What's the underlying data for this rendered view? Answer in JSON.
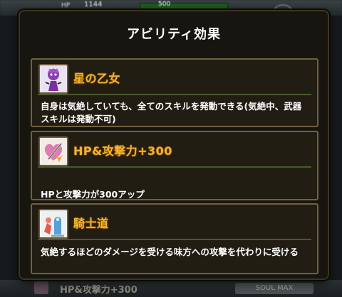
{
  "background": {
    "top_hp_label": "HP",
    "top_hp_value": "1144",
    "top_bar_value": "500",
    "bottom_ghost_title": "HP&攻撃力+300",
    "bottom_ghost_chip": "SOUL MAX"
  },
  "dialog": {
    "title": "アビリティ効果",
    "abilities": [
      {
        "name": "星の乙女",
        "icon": "purple-maiden-icon",
        "description": "自身は気絶していても、全てのスキルを発動できる(気絶中、武器スキルは発動不可)"
      },
      {
        "name": "HP&攻撃力+300",
        "icon": "heart-sword-icon",
        "description": "HPと攻撃力が300アップ"
      },
      {
        "name": "騎士道",
        "icon": "knight-icon",
        "description": "気絶するほどのダメージを受ける味方への攻撃を代わりに受ける"
      }
    ]
  },
  "colors": {
    "ability_name": "#f0b530",
    "card_border": "#70603f",
    "card_bg": "#221d13",
    "separator": "#4a5a2e"
  }
}
